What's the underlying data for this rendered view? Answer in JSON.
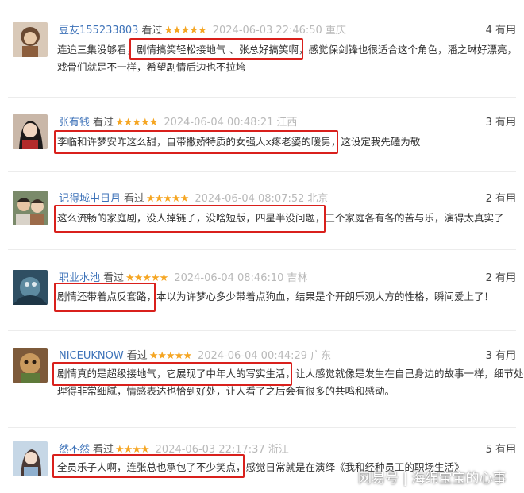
{
  "reviews": [
    {
      "user": "豆友155233803",
      "action": "看过",
      "stars": "★★★★★",
      "time": "2024-06-03 22:46:50",
      "location": "重庆",
      "useful": "4 有用",
      "lines": [
        "连追三集没够看，剧情搞笑轻松接地气 、张总好搞笑啊，感觉保剑锋也很适合这个角色，潘之琳好漂亮，",
        "戏骨们就是不一样，希望剧情后边也不拉垮"
      ],
      "avatar": "doll"
    },
    {
      "user": "张有钱",
      "action": "看过",
      "stars": "★★★★★",
      "time": "2024-06-04 00:48:21",
      "location": "江西",
      "useful": "3 有用",
      "lines": [
        "李临和许梦安咋这么甜，自带撒娇特质的女强人x疼老婆的暖男，这设定我先磕为敬"
      ],
      "avatar": "woman"
    },
    {
      "user": "记得城中日月",
      "action": "看过",
      "stars": "★★★★★",
      "time": "2024-06-04 08:07:52",
      "location": "北京",
      "useful": "2 有用",
      "lines": [
        "这么流畅的家庭剧，没人掉链子，没啥短版，四星半没问题，三个家庭各有各的苦与乐，演得太真实了"
      ],
      "avatar": "couple"
    },
    {
      "user": "职业水池",
      "action": "看过",
      "stars": "★★★★★",
      "time": "2024-06-04 08:46:10",
      "location": "吉林",
      "useful": "2 有用",
      "lines": [
        "剧情还带着点反套路，本以为许梦心多少带着点狗血，结果是个开朗乐观大方的性格，瞬间爱上了！"
      ],
      "avatar": "sea"
    },
    {
      "user": "NICEUKNOW",
      "action": "看过",
      "stars": "★★★★★",
      "time": "2024-06-04 00:44:29",
      "location": "广东",
      "useful": "3 有用",
      "lines": [
        "剧情真的是超级接地气，它展现了中年人的写实生活，让人感觉就像是发生在自己身边的故事一样，细节处",
        "理得非常细腻，情感表达也恰到好处，让人看了之后会有很多的共鸣和感动。"
      ],
      "avatar": "toy"
    },
    {
      "user": "然不然",
      "action": "看过",
      "stars": "★★★★",
      "time": "2024-06-03 22:17:37",
      "location": "浙江",
      "useful": "5 有用",
      "lines": [
        "全员乐子人啊，连张总也承包了不少笑点，感觉日常就是在演绎《我和经种员工的职场生活》"
      ],
      "avatar": "girl"
    }
  ],
  "watermark": "网易号 | 海绵宝宝的心事"
}
